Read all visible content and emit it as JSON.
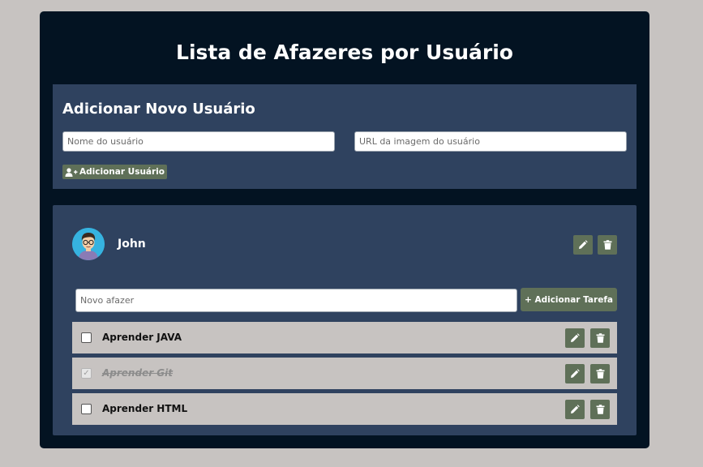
{
  "page": {
    "title": "Lista de Afazeres por Usuário"
  },
  "add_user": {
    "section_title": "Adicionar Novo Usuário",
    "name_placeholder": "Nome do usuário",
    "url_placeholder": "URL da imagem do usuário",
    "button_label": "Adicionar Usuário",
    "button_icon": "user-plus-icon"
  },
  "users": [
    {
      "name": "John",
      "avatar": "cartoon-man-with-glasses",
      "edit_icon": "pencil-icon",
      "delete_icon": "trash-icon",
      "todo_placeholder": "Novo afazer",
      "add_task_label": "+ Adicionar Tarefa",
      "tasks": [
        {
          "label": "Aprender JAVA",
          "done": false
        },
        {
          "label": "Aprender Git",
          "done": true
        },
        {
          "label": "Aprender HTML",
          "done": false
        }
      ]
    }
  ],
  "colors": {
    "background": "#c7c3c1",
    "container": "#031322",
    "panel": "#2f425f",
    "button": "#5f7058",
    "task_row": "#c7c3c1"
  }
}
